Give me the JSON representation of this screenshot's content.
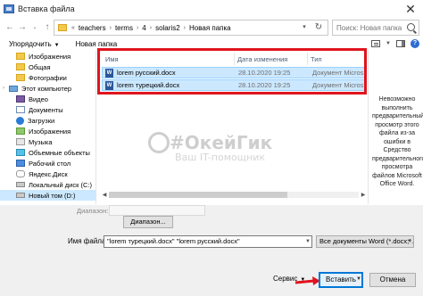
{
  "window": {
    "title": "Вставка файла",
    "close_glyph": "✕"
  },
  "address": {
    "crumbs": [
      "teachers",
      "terms",
      "4",
      "solaris2",
      "Новая папка"
    ],
    "prefix": "«",
    "separator": "›"
  },
  "search": {
    "placeholder": "Поиск: Новая папка"
  },
  "toolbar": {
    "organize_label": "Упорядочить",
    "new_folder_label": "Новая папка"
  },
  "nav": {
    "items": [
      {
        "label": "Изображения",
        "icon": "folder",
        "indent": 1
      },
      {
        "label": "Общая",
        "icon": "folder",
        "indent": 1
      },
      {
        "label": "Фотографии",
        "icon": "folder",
        "indent": 1
      },
      {
        "label": "Этот компьютер",
        "icon": "pc",
        "indent": 0
      },
      {
        "label": "Видео",
        "icon": "video",
        "indent": 1
      },
      {
        "label": "Документы",
        "icon": "docs",
        "indent": 1
      },
      {
        "label": "Загрузки",
        "icon": "down",
        "indent": 1
      },
      {
        "label": "Изображения",
        "icon": "img",
        "indent": 1
      },
      {
        "label": "Музыка",
        "icon": "music",
        "indent": 1
      },
      {
        "label": "Объемные объекты",
        "icon": "d3",
        "indent": 1
      },
      {
        "label": "Рабочий стол",
        "icon": "desk",
        "indent": 1
      },
      {
        "label": "Яндекс.Диск",
        "icon": "yandex",
        "indent": 1
      },
      {
        "label": "Локальный диск (C:)",
        "icon": "disk",
        "indent": 1
      },
      {
        "label": "Новый том (D:)",
        "icon": "disk",
        "indent": 1
      }
    ]
  },
  "files": {
    "headers": {
      "name": "Имя",
      "date": "Дата изменения",
      "type": "Тип"
    },
    "rows": [
      {
        "name": "lorem русский.docx",
        "date": "28.10.2020 19:25",
        "type": "Документ Micros..."
      },
      {
        "name": "lorem турецкий.docx",
        "date": "28.10.2020 19:25",
        "type": "Документ Micros..."
      }
    ]
  },
  "preview": {
    "text": "Невозможно выполнить предварительный просмотр этого файла из-за ошибки в Средство предварительного просмотра файлов Microsoft Office Word."
  },
  "watermark": {
    "title": "#ОкейГик",
    "subtitle": "Ваш IT-помощник"
  },
  "bottom": {
    "range_label": "Диапазон:",
    "range_button": "Диапазон...",
    "filename_label": "Имя файла:",
    "filename_value": "\"lorem турецкий.docx\" \"lorem русский.docx\"",
    "filter_value": "Все документы Word (*.docx;*.d",
    "service_label": "Сервис",
    "insert_label": "Вставить",
    "cancel_label": "Отмена"
  },
  "colors": {
    "highlight": "#e0141e",
    "selection": "#cce8ff",
    "accent": "#0078d7"
  }
}
